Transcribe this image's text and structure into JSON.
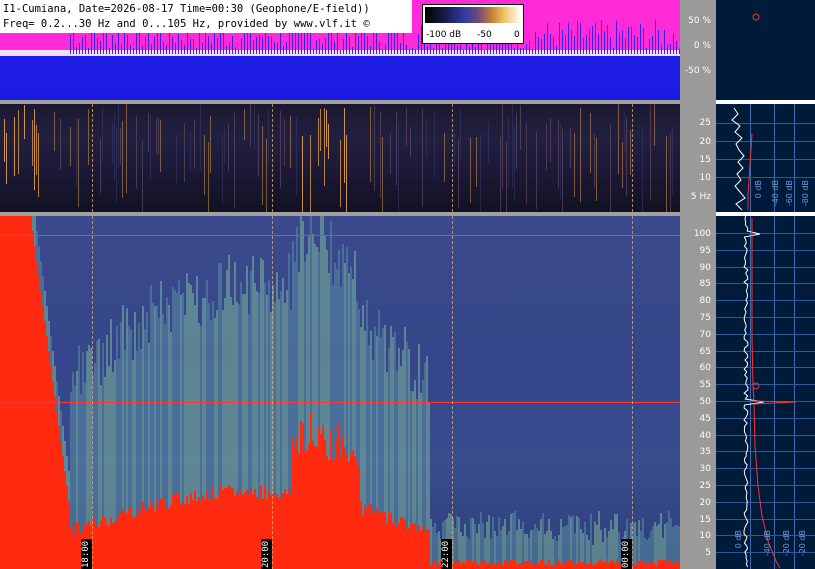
{
  "header": {
    "line1": "I1-Cumiana, Date=2026-08-17 Time=00:30 (Geophone/E-field))",
    "line2": "Freq= 0.2...30 Hz and 0...105 Hz, provided by www.vlf.it ©"
  },
  "colorbar": {
    "ticks": [
      "-100 dB",
      "-50",
      "0"
    ]
  },
  "top_axis": {
    "labels": [
      "50 %",
      "0 %",
      "-50 %"
    ]
  },
  "mid_axis": {
    "labels": [
      "25",
      "20",
      "15",
      "10",
      "5 Hz"
    ]
  },
  "main_axis": {
    "labels": [
      "100",
      "95",
      "90",
      "85",
      "80",
      "75",
      "70",
      "65",
      "60",
      "55",
      "50",
      "45",
      "40",
      "35",
      "30",
      "25",
      "20",
      "15",
      "10",
      "5"
    ]
  },
  "time_labels": [
    "18:00",
    "20:00",
    "22:00",
    "00:00"
  ],
  "profile": {
    "mid_db_labels": [
      "0 dB",
      "-40 dB",
      "-60 dB",
      "-80 dB"
    ],
    "main_db_labels": [
      "0 dB",
      "-40 dB",
      "-20 dB",
      "-20 dB"
    ]
  },
  "colors": {
    "top_magenta": "#ff2bd8",
    "top_blue": "#1f1fe6",
    "spectrogram_blue": "#3a4a8c",
    "power_line_red": "#ff3a2a",
    "profile_bg": "#001a3a"
  }
}
